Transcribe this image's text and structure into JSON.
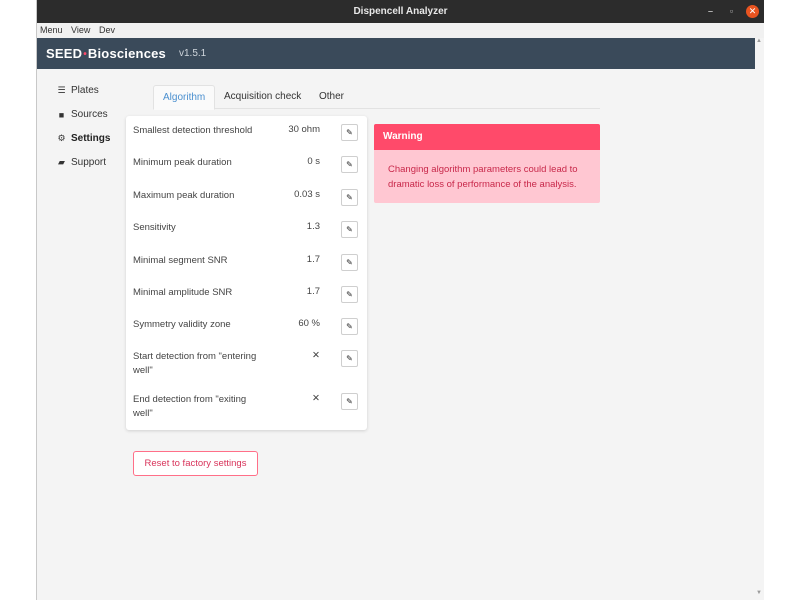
{
  "window": {
    "title": "Dispencell Analyzer",
    "min": "–",
    "max": "▫",
    "close": "✕"
  },
  "menubar": [
    "Menu",
    "View",
    "Dev"
  ],
  "header": {
    "brand_seed": "SEED",
    "brand_dot": "•",
    "brand_rest": "Biosciences",
    "version": "v1.5.1"
  },
  "sidebar": [
    {
      "label": "Plates",
      "icon": "list-icon"
    },
    {
      "label": "Sources",
      "icon": "folder-icon"
    },
    {
      "label": "Settings",
      "icon": "gears-icon",
      "active": true
    },
    {
      "label": "Support",
      "icon": "comment-icon"
    }
  ],
  "tabs": [
    {
      "label": "Algorithm",
      "active": true
    },
    {
      "label": "Acquisition check"
    },
    {
      "label": "Other"
    }
  ],
  "params": [
    {
      "label": "Smallest detection threshold",
      "value": "30 ohm"
    },
    {
      "label": "Minimum peak duration",
      "value": "0 s"
    },
    {
      "label": "Maximum peak duration",
      "value": "0.03 s"
    },
    {
      "label": "Sensitivity",
      "value": "1.3"
    },
    {
      "label": "Minimal segment SNR",
      "value": "1.7"
    },
    {
      "label": "Minimal amplitude SNR",
      "value": "1.7"
    },
    {
      "label": "Symmetry validity zone",
      "value": "60 %"
    },
    {
      "label": "Start detection from \"entering well\"",
      "value": "✕"
    },
    {
      "label": "End detection from \"exiting well\"",
      "value": "✕"
    }
  ],
  "edit_glyph": "✎",
  "warning": {
    "title": "Warning",
    "message": "Changing algorithm parameters could lead to dramatic loss of performance of the analysis."
  },
  "reset_label": "Reset to factory settings",
  "colors": {
    "header_bg": "#3a4a5a",
    "accent_pink": "#ff4a6a",
    "warning_bg": "#ffc7d2",
    "tab_active": "#4a8fcf"
  }
}
